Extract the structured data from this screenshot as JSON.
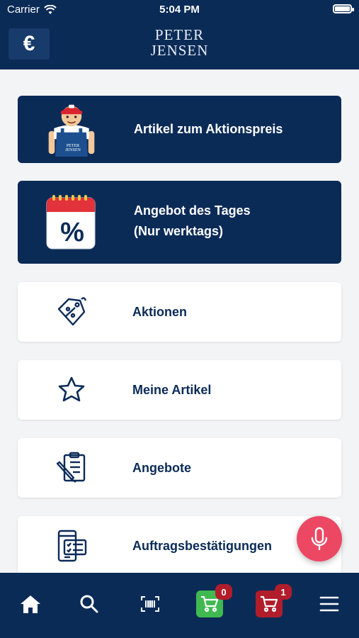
{
  "status_bar": {
    "carrier": "Carrier",
    "time": "5:04 PM"
  },
  "header": {
    "currency_symbol": "€",
    "logo_line1": "PETER",
    "logo_line2": "JENSEN"
  },
  "menu": {
    "promo_price": {
      "label": "Artikel zum Aktionspreis",
      "mascot_shirt_text": "PETER JENSEN"
    },
    "deal_of_day": {
      "line1": "Angebot des Tages",
      "line2": "(Nur werktags)",
      "calendar_symbol": "%"
    },
    "promotions": {
      "label": "Aktionen"
    },
    "my_items": {
      "label": "Meine Artikel"
    },
    "offers": {
      "label": "Angebote"
    },
    "order_confirmations": {
      "label": "Auftragsbestätigungen"
    }
  },
  "tab_bar": {
    "cart_green_count": "0",
    "cart_red_count": "1"
  },
  "colors": {
    "navy": "#0b2b57",
    "fab_pink": "#ec4863",
    "cart_green": "#3fb950",
    "cart_red": "#b21d2b",
    "background": "#f3f4f6"
  }
}
